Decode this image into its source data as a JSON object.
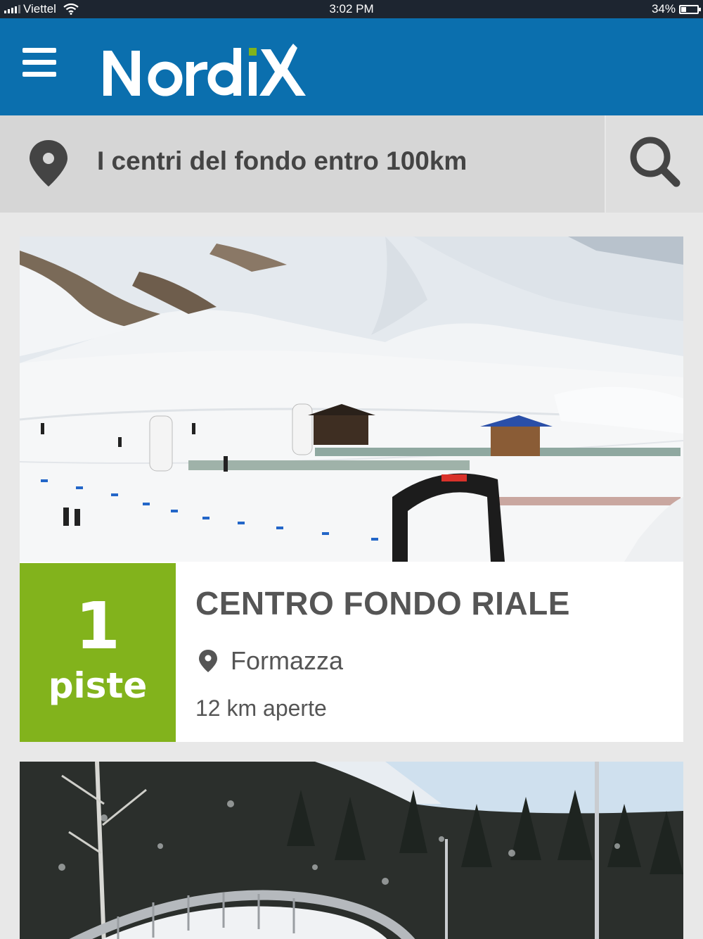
{
  "status_bar": {
    "carrier": "Viettel",
    "time": "3:02 PM",
    "battery": "34%",
    "battery_level": 0.34
  },
  "header": {
    "logo_text": "NordiX",
    "menu_icon": "hamburger-menu-icon"
  },
  "search": {
    "text": "I centri del fondo entro 100km",
    "location_icon": "map-pin-icon",
    "search_icon": "search-icon"
  },
  "cards": [
    {
      "badge_number": "1",
      "badge_label": "piste",
      "title": "CENTRO FONDO RIALE",
      "location": "Formazza",
      "km": "12 km aperte",
      "badge_color": "#82b31c"
    }
  ],
  "colors": {
    "header_bg": "#0b6fae",
    "accent_green": "#82b31c",
    "search_bg": "#d6d6d6"
  }
}
